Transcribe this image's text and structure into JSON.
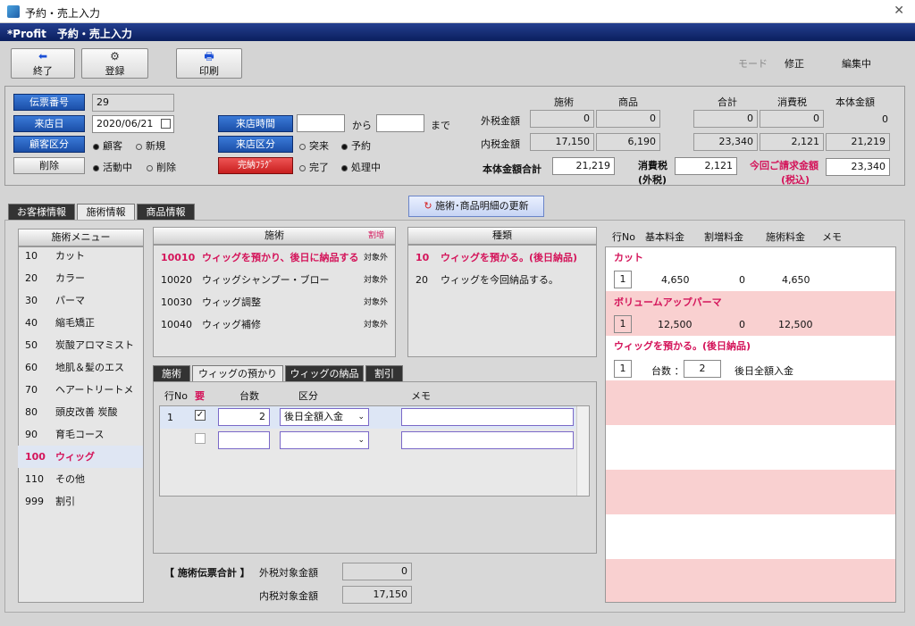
{
  "window": {
    "title": "予約・売上入力",
    "close": "✕"
  },
  "app_header": "*Profit　予約・売上入力",
  "toolbar": {
    "exit": "終了",
    "save": "登録",
    "print": "印刷"
  },
  "mode": {
    "label": "モード",
    "value": "修正",
    "status": "編集中"
  },
  "slip": {
    "number_label": "伝票番号",
    "number": "29",
    "date_label": "来店日",
    "date": "2020/06/21",
    "customer_type_label": "顧客区分",
    "opt_customer": "顧客",
    "opt_new": "新規",
    "delete_label": "削除",
    "opt_active": "活動中",
    "opt_deleted": "削除",
    "time_label": "来店時間",
    "from": "から",
    "until": "まで",
    "visit_type_label": "来店区分",
    "opt_walkin": "突来",
    "opt_reserve": "予約",
    "complete_flag_label": "完納ﾌﾗｸﾞ",
    "opt_complete": "完了",
    "opt_processing": "処理中"
  },
  "amounts": {
    "hdr_service": "施術",
    "hdr_product": "商品",
    "hdr_total": "合計",
    "hdr_tax": "消費税",
    "hdr_body": "本体金額",
    "ext_label": "外税金額",
    "ext": [
      "0",
      "0",
      "0",
      "0",
      "0"
    ],
    "int_label": "内税金額",
    "int": [
      "17,150",
      "6,190",
      "23,340",
      "2,121",
      "21,219"
    ],
    "body_total_label": "本体金額合計",
    "body_total": "21,219",
    "tax_label1": "消費税",
    "tax_label2": "(外税)",
    "tax": "2,121",
    "billing_label1": "今回ご請求金額",
    "billing_label2": "(税込)",
    "billing": "23,340"
  },
  "tabs": [
    "お客様情報",
    "施術情報",
    "商品情報"
  ],
  "refresh_button": "施術･商品明細の更新",
  "service_menu": {
    "header": "施術メニュー",
    "items": [
      [
        "10",
        "カット"
      ],
      [
        "20",
        "カラー"
      ],
      [
        "30",
        "パーマ"
      ],
      [
        "40",
        "縮毛矯正"
      ],
      [
        "50",
        "炭酸アロマミスト"
      ],
      [
        "60",
        "地肌＆髪のエス"
      ],
      [
        "70",
        "ヘアートリートメ"
      ],
      [
        "80",
        "頭皮改善 炭酸"
      ],
      [
        "90",
        "育毛コース"
      ],
      [
        "100",
        "ウィッグ"
      ],
      [
        "110",
        "その他"
      ],
      [
        "999",
        "割引"
      ]
    ]
  },
  "service_list": {
    "header": "施術",
    "discount": "割増",
    "rows": [
      [
        "10010",
        "ウィッグを預かり、後日に納品する",
        "対象外"
      ],
      [
        "10020",
        "ウィッグシャンプー・ブロー",
        "対象外"
      ],
      [
        "10030",
        "ウィッグ調整",
        "対象外"
      ],
      [
        "10040",
        "ウィッグ補修",
        "対象外"
      ]
    ]
  },
  "type_list": {
    "header": "種類",
    "rows": [
      [
        "10",
        "ウィッグを預かる。(後日納品)"
      ],
      [
        "20",
        "ウィッグを今回納品する。"
      ]
    ]
  },
  "subtabs": [
    "施術",
    "ウィッグの預かり",
    "ウィッグの納品",
    "割引"
  ],
  "subgrid": {
    "hdr_row": "行No",
    "hdr_req": "要",
    "hdr_qty": "台数",
    "hdr_kubun": "区分",
    "hdr_memo": "メモ",
    "row1_no": "1",
    "row1_qty": "2",
    "row1_kubun": "後日全額入金"
  },
  "totals": {
    "label": "【 施術伝票合計 】",
    "ext_label": "外税対象金額",
    "ext": "0",
    "int_label": "内税対象金額",
    "int": "17,150"
  },
  "detail": {
    "hdr_row": "行No",
    "hdr_base": "基本料金",
    "hdr_extra": "割増料金",
    "hdr_fee": "施術料金",
    "hdr_memo": "メモ",
    "groups": [
      {
        "title": "カット",
        "no": "1",
        "base": "4,650",
        "extra": "0",
        "fee": "4,650"
      },
      {
        "title": "ボリュームアップパーマ",
        "no": "1",
        "base": "12,500",
        "extra": "0",
        "fee": "12,500"
      }
    ],
    "wig_title": "ウィッグを預かる。(後日納品)",
    "wig_no": "1",
    "wig_qty_label": "台数 ：",
    "wig_qty": "2",
    "wig_note": "後日全額入金"
  }
}
